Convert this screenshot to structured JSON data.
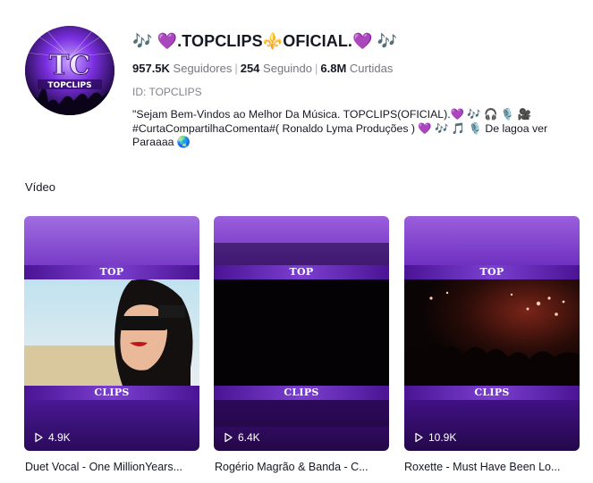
{
  "profile": {
    "name": "🎶 💜.TOPCLIPS⚜️OFICIAL.💜 🎶",
    "avatar_text_top": "TC",
    "avatar_text_bottom": "TOPCLIPS",
    "followers_count": "957.5K",
    "followers_label": "Seguidores",
    "following_count": "254",
    "following_label": "Seguindo",
    "likes_count": "6.8M",
    "likes_label": "Curtidas",
    "user_id": "ID: TOPCLIPS",
    "bio": "\"Sejam Bem-Vindos ao Melhor Da Música. TOPCLIPS(OFICIAL).💜 🎶 🎧 🎙️ 🎥\n#CurtaCompartilhaComenta#( Ronaldo Lyma Produções ) 💜 🎶 🎵 🎙️ De lagoa ver\nParaaaa 🌏"
  },
  "videos_section": {
    "label": "Vídeo"
  },
  "videos": [
    {
      "band_top": "TOP",
      "band_bottom": "CLIPS",
      "views": "4.9K",
      "title": "Duet Vocal - One MillionYears..."
    },
    {
      "band_top": "TOP",
      "band_bottom": "CLIPS",
      "views": "6.4K",
      "title": "Rogério Magrão & Banda - C..."
    },
    {
      "band_top": "TOP",
      "band_bottom": "CLIPS",
      "views": "10.9K",
      "title": "Roxette - Must Have Been Lo..."
    }
  ],
  "colors": {
    "accent_purple": "#6a2bc4",
    "text_primary": "#161823",
    "text_secondary": "#8a8b91"
  },
  "icons": {
    "play": "play-icon"
  }
}
